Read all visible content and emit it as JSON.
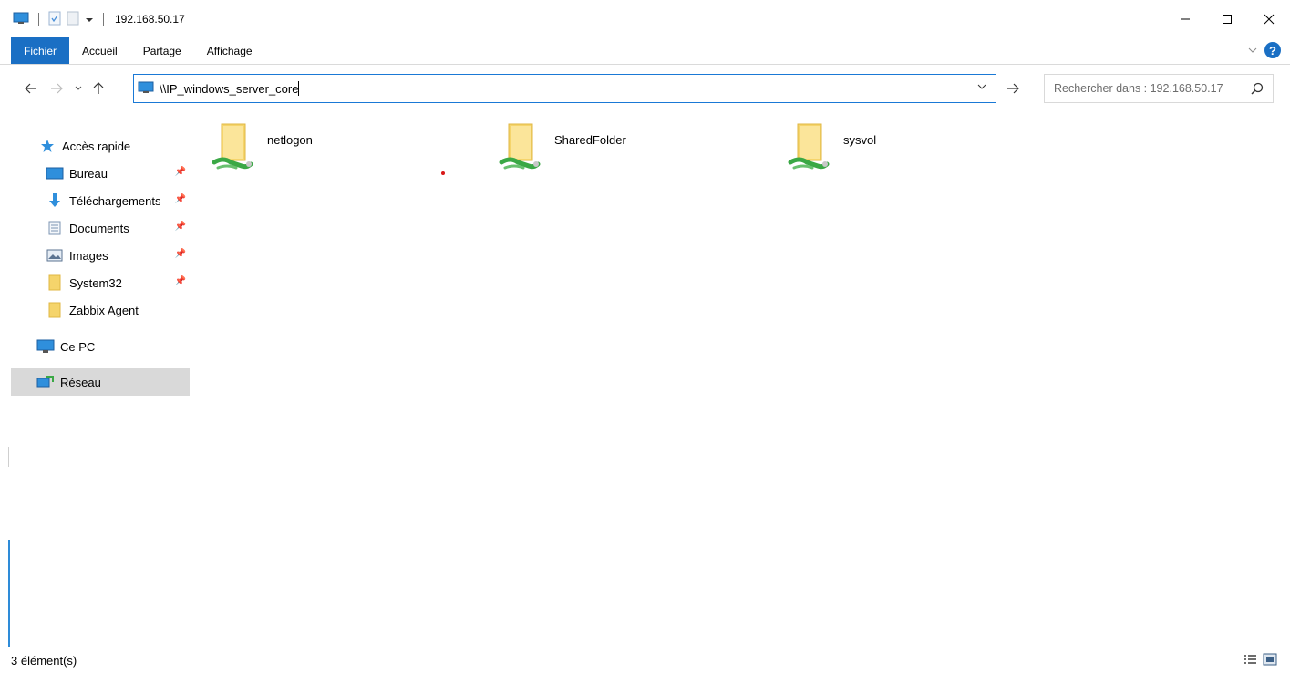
{
  "window": {
    "title": "192.168.50.17",
    "controls": [
      "minimize",
      "maximize",
      "close"
    ]
  },
  "ribbon": {
    "tabs": [
      {
        "label": "Fichier",
        "active": true
      },
      {
        "label": "Accueil"
      },
      {
        "label": "Partage"
      },
      {
        "label": "Affichage"
      }
    ]
  },
  "address": {
    "value": "\\\\IP_windows_server_core"
  },
  "search": {
    "placeholder": "Rechercher dans : 192.168.50.17"
  },
  "sidebar": {
    "items": [
      {
        "label": "Accès rapide",
        "icon": "star-icon"
      },
      {
        "label": "Bureau",
        "icon": "desktop-icon",
        "pinned": true
      },
      {
        "label": "Téléchargements",
        "icon": "download-icon",
        "pinned": true
      },
      {
        "label": "Documents",
        "icon": "document-icon",
        "pinned": true
      },
      {
        "label": "Images",
        "icon": "images-icon",
        "pinned": true
      },
      {
        "label": "System32",
        "icon": "folder-icon",
        "pinned": true
      },
      {
        "label": "Zabbix Agent",
        "icon": "folder-icon"
      },
      {
        "label": "Ce PC",
        "icon": "computer-icon"
      },
      {
        "label": "Réseau",
        "icon": "network-icon",
        "selected": true
      }
    ]
  },
  "shares": [
    {
      "name": "netlogon"
    },
    {
      "name": "SharedFolder"
    },
    {
      "name": "sysvol"
    }
  ],
  "status": {
    "count": "3 élément(s)"
  },
  "colors": {
    "accent": "#1a6fc4",
    "selected": "#d9d9d9",
    "folder": "#f5d46b",
    "share_green": "#3aa845"
  }
}
